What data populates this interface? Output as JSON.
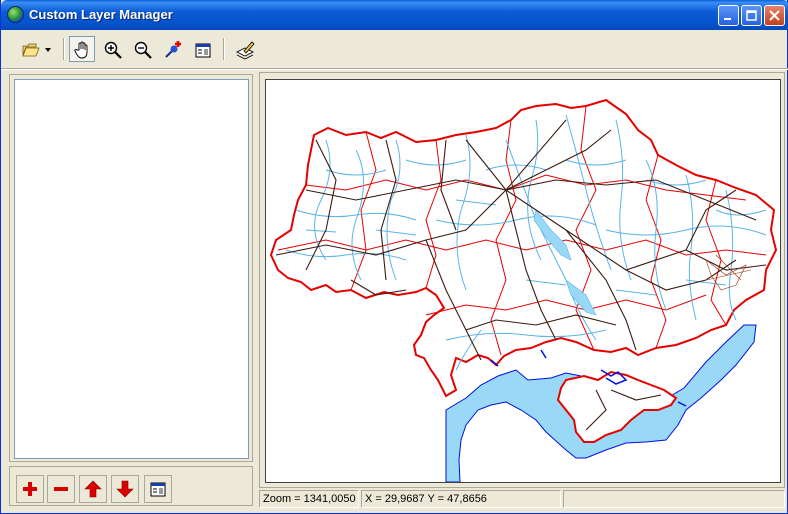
{
  "window": {
    "title": "Custom Layer Manager"
  },
  "toolbar": {
    "tools": [
      {
        "name": "open-file",
        "icon": "folder-open-icon"
      },
      {
        "name": "pan",
        "icon": "hand-icon"
      },
      {
        "name": "zoom-in",
        "icon": "zoom-in-icon"
      },
      {
        "name": "zoom-out",
        "icon": "zoom-out-icon"
      },
      {
        "name": "add-point",
        "icon": "pushpin-add-icon"
      },
      {
        "name": "properties",
        "icon": "properties-icon"
      },
      {
        "name": "edit",
        "icon": "pencil-edit-icon"
      }
    ]
  },
  "layer_panel": {
    "buttons": [
      {
        "name": "add-layer",
        "icon": "plus-icon"
      },
      {
        "name": "remove-layer",
        "icon": "minus-icon"
      },
      {
        "name": "move-up",
        "icon": "arrow-up-icon"
      },
      {
        "name": "move-down",
        "icon": "arrow-down-icon"
      },
      {
        "name": "layer-properties",
        "icon": "properties-icon"
      }
    ]
  },
  "status": {
    "zoom": "Zoom = 1341,0050",
    "coords": "X = 29,9687 Y = 47,8656",
    "extra": ""
  },
  "colors": {
    "border_red": "#e60000",
    "rivers": "#5ab4e6",
    "roads": "#3a1a10",
    "sea": "#99d9f7",
    "water_blue": "#0010e0"
  }
}
